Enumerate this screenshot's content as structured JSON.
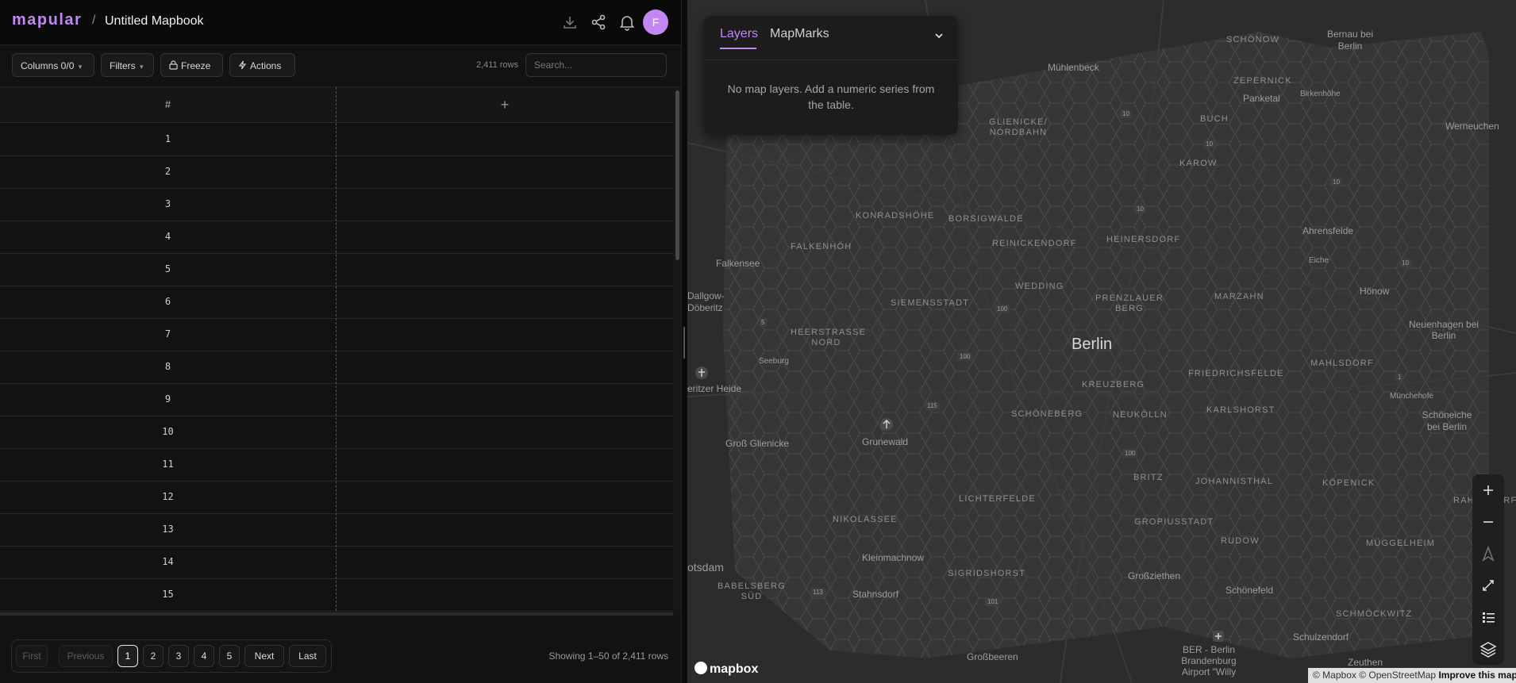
{
  "app": {
    "logo": "mapular",
    "separator": "/",
    "title": "Untitled Mapbook",
    "avatar_initial": "F",
    "accent": "#c387f2",
    "icons": [
      "download-icon",
      "share-icon",
      "bell-icon"
    ]
  },
  "toolbar": {
    "columns_label": "Columns 0/0",
    "filters_label": "Filters",
    "freeze_label": "Freeze",
    "actions_label": "Actions",
    "rows_count": "2,411 rows",
    "search_placeholder": "Search..."
  },
  "table": {
    "header_num": "#",
    "header_add": "+",
    "rows": [
      "1",
      "2",
      "3",
      "4",
      "5",
      "6",
      "7",
      "8",
      "9",
      "10",
      "11",
      "12",
      "13",
      "14",
      "15"
    ]
  },
  "pagination": {
    "first": "First",
    "previous": "Previous",
    "pages": [
      "1",
      "2",
      "3",
      "4",
      "5"
    ],
    "current_page": "1",
    "next": "Next",
    "last": "Last",
    "showing": "Showing 1–50 of 2,411 rows"
  },
  "layers_panel": {
    "tabs": [
      "Layers",
      "MapMarks"
    ],
    "active_tab": "Layers",
    "message": "No map layers. Add a numeric series from the table."
  },
  "map": {
    "labels": [
      {
        "text": "Berlin",
        "style": "big"
      },
      {
        "text": "SCHÖNOW",
        "style": "caps"
      },
      {
        "text": "Bernau bei Berlin",
        "style": "normal"
      },
      {
        "text": "Mühlenbeck",
        "style": "normal"
      },
      {
        "text": "ZEPERNICK",
        "style": "caps"
      },
      {
        "text": "Panketal",
        "style": "normal"
      },
      {
        "text": "Birkenhöhe",
        "style": "normal"
      },
      {
        "text": "GLIENICKE/ NORDBAHN",
        "style": "caps"
      },
      {
        "text": "BUCH",
        "style": "caps"
      },
      {
        "text": "Werneuchen",
        "style": "normal"
      },
      {
        "text": "KAROW",
        "style": "caps"
      },
      {
        "text": "KONRADSHÖHE",
        "style": "caps"
      },
      {
        "text": "BORSIGWALDE",
        "style": "caps"
      },
      {
        "text": "REINICKENDORF",
        "style": "caps"
      },
      {
        "text": "HEINERSDORF",
        "style": "caps"
      },
      {
        "text": "Ahrensfelde",
        "style": "normal"
      },
      {
        "text": "FALKENHÖH",
        "style": "caps"
      },
      {
        "text": "Falkensee",
        "style": "normal"
      },
      {
        "text": "Eiche",
        "style": "normal"
      },
      {
        "text": "WEDDING",
        "style": "caps"
      },
      {
        "text": "PRENZLAUER BERG",
        "style": "caps"
      },
      {
        "text": "MARZAHN",
        "style": "caps"
      },
      {
        "text": "Hönow",
        "style": "normal"
      },
      {
        "text": "Dallgow-Döberitz",
        "style": "normal"
      },
      {
        "text": "SIEMENSSTADT",
        "style": "caps"
      },
      {
        "text": "HEERSTRASSE NORD",
        "style": "caps"
      },
      {
        "text": "Neuenhagen bei Berlin",
        "style": "normal"
      },
      {
        "text": "Seeburg",
        "style": "normal"
      },
      {
        "text": "FRIEDRICHSFELDE",
        "style": "caps"
      },
      {
        "text": "MAHLSDORF",
        "style": "caps"
      },
      {
        "text": "KREUZBERG",
        "style": "caps"
      },
      {
        "text": "Münchehofe",
        "style": "normal"
      },
      {
        "text": "eritzer Heide",
        "style": "normal"
      },
      {
        "text": "SCHÖNEBERG",
        "style": "caps"
      },
      {
        "text": "NEUKÖLLN",
        "style": "caps"
      },
      {
        "text": "KARLSHORST",
        "style": "caps"
      },
      {
        "text": "Schöneiche bei Berlin",
        "style": "normal"
      },
      {
        "text": "Grunewald",
        "style": "normal"
      },
      {
        "text": "Groß Glienicke",
        "style": "normal"
      },
      {
        "text": "BRITZ",
        "style": "caps"
      },
      {
        "text": "JOHANNISTHAL",
        "style": "caps"
      },
      {
        "text": "KÖPENICK",
        "style": "caps"
      },
      {
        "text": "RAHNSDORF",
        "style": "caps"
      },
      {
        "text": "LICHTERFELDE",
        "style": "caps"
      },
      {
        "text": "NIKOLASSEE",
        "style": "caps"
      },
      {
        "text": "GROPIUSSTADT",
        "style": "caps"
      },
      {
        "text": "RUDOW",
        "style": "caps"
      },
      {
        "text": "MÜGGELHEIM",
        "style": "caps"
      },
      {
        "text": "Kleinmachnow",
        "style": "normal"
      },
      {
        "text": "otsdam",
        "style": "normal"
      },
      {
        "text": "BABELSBERG SÜD",
        "style": "caps"
      },
      {
        "text": "Stahnsdorf",
        "style": "normal"
      },
      {
        "text": "SIGRIDSHORST",
        "style": "caps"
      },
      {
        "text": "Großziethen",
        "style": "normal"
      },
      {
        "text": "Schönefeld",
        "style": "normal"
      },
      {
        "text": "SCHMÖCKWITZ",
        "style": "caps"
      },
      {
        "text": "Schulzendorf",
        "style": "normal"
      },
      {
        "text": "BER - Berlin Brandenburg Airport \"Willy",
        "style": "normal"
      },
      {
        "text": "Großbeeren",
        "style": "normal"
      },
      {
        "text": "Zeuthen",
        "style": "normal"
      }
    ],
    "road_shields": [
      "10",
      "10",
      "10",
      "10",
      "10",
      "5",
      "100",
      "100",
      "115",
      "100",
      "113",
      "101",
      "1"
    ],
    "controls": [
      "zoom-in-icon",
      "zoom-out-icon",
      "compass-icon",
      "fullscreen-icon",
      "legend-icon",
      "layers-icon"
    ],
    "attribution_copy": "© Mapbox © OpenStreetMap",
    "attribution_link": "Improve this map",
    "mapbox_logo": "mapbox"
  }
}
